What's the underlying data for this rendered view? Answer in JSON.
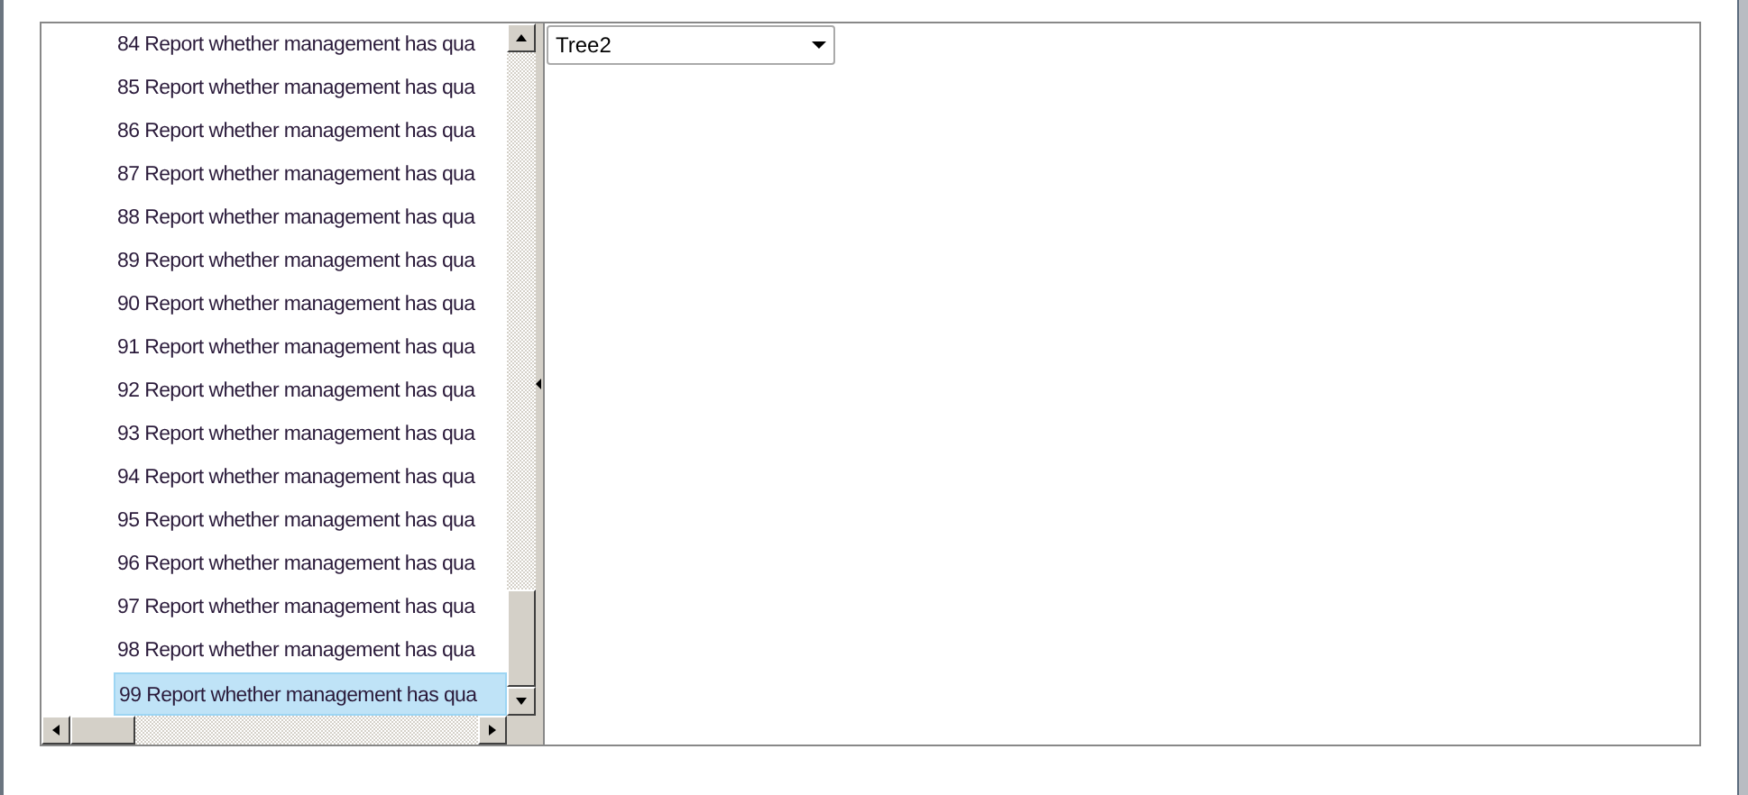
{
  "tree": {
    "items": [
      {
        "label": "84 Report whether management has qua",
        "selected": false
      },
      {
        "label": "85 Report whether management has qua",
        "selected": false
      },
      {
        "label": "86 Report whether management has qua",
        "selected": false
      },
      {
        "label": "87 Report whether management has qua",
        "selected": false
      },
      {
        "label": "88 Report whether management has qua",
        "selected": false
      },
      {
        "label": "89 Report whether management has qua",
        "selected": false
      },
      {
        "label": "90 Report whether management has qua",
        "selected": false
      },
      {
        "label": "91 Report whether management has qua",
        "selected": false
      },
      {
        "label": "92 Report whether management has qua",
        "selected": false
      },
      {
        "label": "93 Report whether management has qua",
        "selected": false
      },
      {
        "label": "94 Report whether management has qua",
        "selected": false
      },
      {
        "label": "95 Report whether management has qua",
        "selected": false
      },
      {
        "label": "96 Report whether management has qua",
        "selected": false
      },
      {
        "label": "97 Report whether management has qua",
        "selected": false
      },
      {
        "label": "98 Report whether management has qua",
        "selected": false
      },
      {
        "label": "99 Report whether management has qua",
        "selected": true
      }
    ]
  },
  "tree_selector": {
    "value": "Tree2"
  }
}
